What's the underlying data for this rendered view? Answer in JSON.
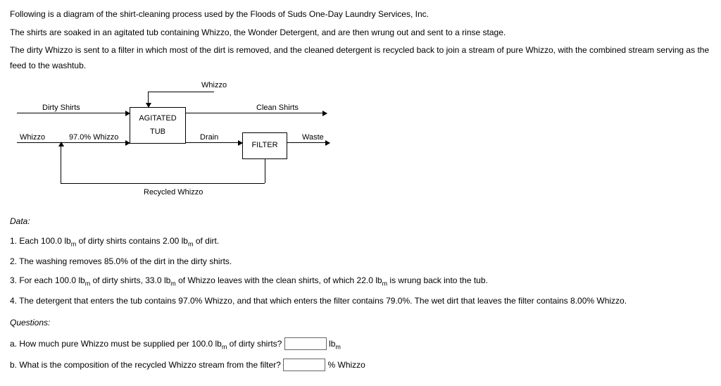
{
  "intro": {
    "p1": "Following is a diagram of the shirt-cleaning process used by the Floods of Suds One-Day Laundry Services, Inc.",
    "p2": "The shirts are soaked in an agitated tub containing Whizzo, the Wonder Detergent, and are then wrung out and sent to a rinse stage.",
    "p3": "The dirty Whizzo is sent to a filter in which most of the dirt is removed, and the cleaned detergent is recycled back to join a stream of pure Whizzo, with the combined stream serving as the feed to the washtub."
  },
  "diagram": {
    "whizzo_top": "Whizzo",
    "dirty_shirts": "Dirty Shirts",
    "clean_shirts": "Clean Shirts",
    "whizzo_in": "Whizzo",
    "pct_whizzo": "97.0% Whizzo",
    "tub": "AGITATED\nTUB",
    "drain": "Drain",
    "filter": "FILTER",
    "waste": "Waste",
    "recycled": "Recycled Whizzo"
  },
  "data_title": "Data:",
  "data_items": {
    "d1_pre": "1. Each 100.0 lb",
    "d1_post": " of dirty shirts contains 2.00 lb",
    "d1_end": " of dirt.",
    "d2": "2. The washing removes 85.0% of the dirt in the dirty shirts.",
    "d3_pre": "3. For each 100.0 lb",
    "d3_mid": " of dirty shirts, 33.0 lb",
    "d3_mid2": " of Whizzo leaves with the clean shirts, of which 22.0 lb",
    "d3_end": " is wrung back into the tub.",
    "d4": "4. The detergent that enters the tub contains 97.0% Whizzo, and that which enters the filter contains 79.0%. The wet dirt that leaves the filter contains 8.00% Whizzo."
  },
  "questions_title": "Questions:",
  "qa": {
    "a_pre": "a. How much pure Whizzo must be supplied per 100.0 lb",
    "a_post": " of dirty shirts?",
    "a_unit": "lb",
    "b_pre": "b. What is the composition of the recycled Whizzo stream from the filter?",
    "b_unit": "% Whizzo"
  },
  "sub_m": "m"
}
